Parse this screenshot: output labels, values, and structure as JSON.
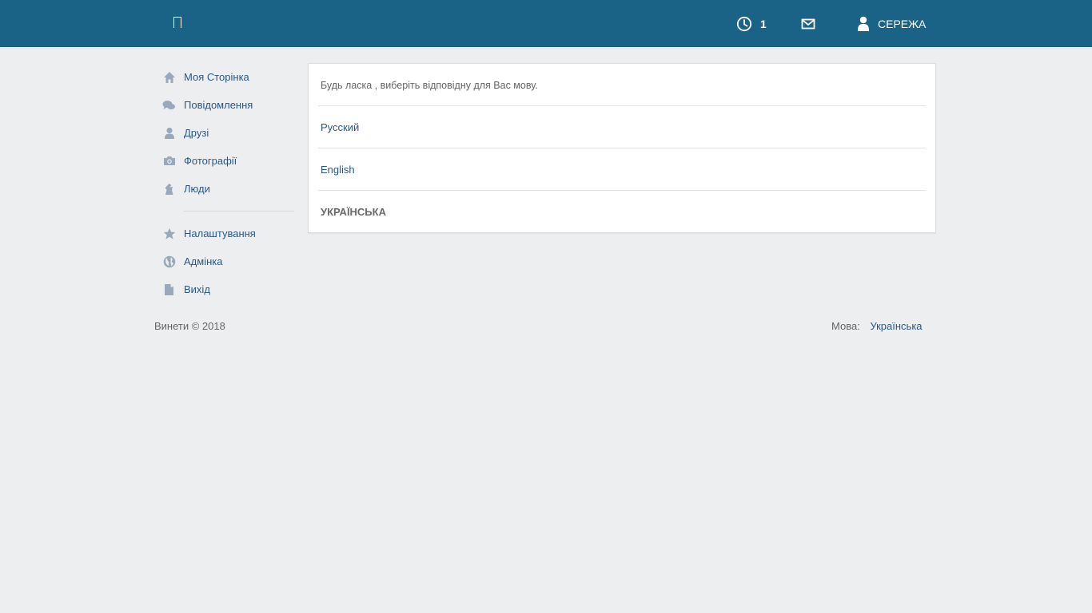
{
  "colors": {
    "header_bg": "#1a6387",
    "page_bg": "#edeef0",
    "link": "#2a5885",
    "icon": "#99a9bb"
  },
  "header": {
    "logo_icon": "logo-glyph",
    "notifications": {
      "icon": "clock-icon",
      "count": "1"
    },
    "messages": {
      "icon": "mail-icon"
    },
    "user": {
      "icon": "user-icon",
      "name": "СЕРЕЖА"
    }
  },
  "sidebar": {
    "items": [
      {
        "label": "Моя Сторінка",
        "icon": "home-icon"
      },
      {
        "label": "Повідомлення",
        "icon": "chat-icon"
      },
      {
        "label": "Друзі",
        "icon": "friend-icon"
      },
      {
        "label": "Фотографії",
        "icon": "camera-icon"
      },
      {
        "label": "Люди",
        "icon": "people-icon"
      }
    ],
    "secondary": [
      {
        "label": "Налаштування",
        "icon": "star-icon"
      },
      {
        "label": "Адмінка",
        "icon": "globe-icon"
      },
      {
        "label": "Вихід",
        "icon": "document-icon"
      }
    ]
  },
  "main": {
    "prompt": "Будь ласка , виберіть відповідну для Вас мову.",
    "languages": [
      {
        "label": "Русский",
        "active": false
      },
      {
        "label": "English",
        "active": false
      },
      {
        "label": "УКРАЇНСЬКА",
        "active": true
      }
    ]
  },
  "footer": {
    "copyright": "Винети © 2018",
    "language_label": "Мова:",
    "language_value": "Українська"
  }
}
